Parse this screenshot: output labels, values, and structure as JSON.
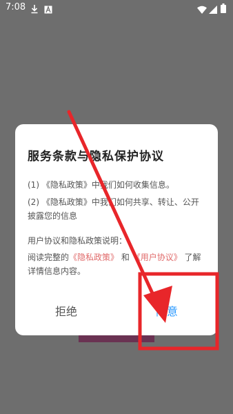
{
  "status_bar": {
    "time": "7:08",
    "icons": [
      "download-icon",
      "a-badge-icon",
      "wifi-icon",
      "signal-icon",
      "battery-icon"
    ]
  },
  "dialog": {
    "title": "服务条款与隐私保护协议",
    "item1": "(1) 《隐私政策》中我们如何收集信息。",
    "item2": "(2) 《隐私政策》中我们如何共享、转让、公开披露您的信息",
    "explain_heading": "用户协议和隐私政策说明：",
    "read_prefix": "阅读完整的",
    "privacy_link": "《隐私政策》",
    "and_text": "和",
    "user_link": "《用户协议》",
    "read_suffix": "了解详情信息内容。",
    "refuse_label": "拒绝",
    "agree_label": "同意"
  },
  "colors": {
    "annotation_red": "#e8262a",
    "agree_blue": "#2e9bff",
    "link_red": "#e06a6a"
  }
}
